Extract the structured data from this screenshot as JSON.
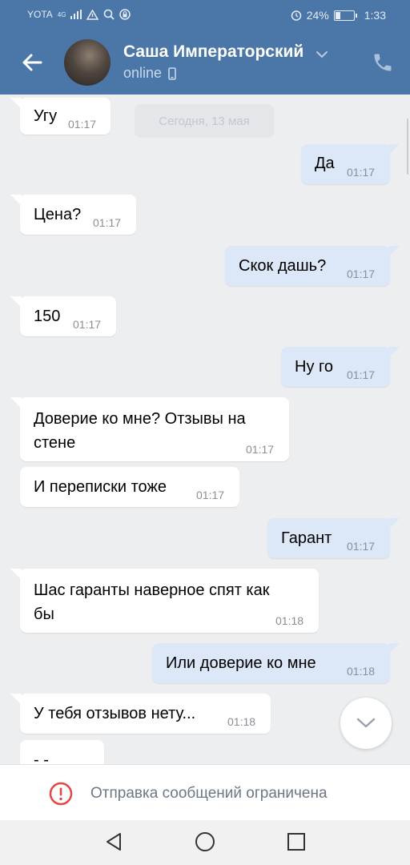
{
  "status_bar": {
    "carrier": "YOTA",
    "network": "4G",
    "battery": "24%",
    "battery_level": 0.24,
    "time": "1:33"
  },
  "header": {
    "contact_name": "Саша Императорский",
    "status": "online"
  },
  "chat": {
    "date_label": "Сегодня, 13 мая",
    "messages": [
      {
        "dir": "in",
        "text": "Угу",
        "time": "01:17"
      },
      {
        "dir": "out",
        "text": "Да",
        "time": "01:17"
      },
      {
        "dir": "in",
        "text": "Цена?",
        "time": "01:17"
      },
      {
        "dir": "out",
        "text": "Скок дашь?",
        "time": "01:17"
      },
      {
        "dir": "in",
        "text": "150",
        "time": "01:17"
      },
      {
        "dir": "out",
        "text": "Ну го",
        "time": "01:17"
      },
      {
        "dir": "in",
        "line1": "Доверие ко мне? Отзывы на",
        "line2": "стене",
        "time": "01:17"
      },
      {
        "dir": "in",
        "text": "И переписки тоже",
        "time": "01:17"
      },
      {
        "dir": "out",
        "text": "Гарант",
        "time": "01:17"
      },
      {
        "dir": "in",
        "line1": "Шас гаранты наверное спят как",
        "line2": "бы",
        "time": "01:18"
      },
      {
        "dir": "out",
        "text": "Или доверие ко мне",
        "time": "01:18"
      },
      {
        "dir": "in",
        "text": "У тебя отзывов нету...",
        "time": "01:18"
      },
      {
        "dir": "in",
        "text": "- -",
        "time": ""
      }
    ]
  },
  "restriction": {
    "text": "Отправка сообщений ограничена"
  },
  "colors": {
    "header_bg": "#4a76a8",
    "incoming_bubble": "#ffffff",
    "outgoing_bubble": "#dce8f7",
    "chat_bg": "#edeef0",
    "warning_red": "#e64646"
  },
  "icons": [
    "back-arrow-icon",
    "chevron-down-icon",
    "mobile-phone-icon",
    "phone-call-icon",
    "scroll-down-icon",
    "warning-icon",
    "nav-back-icon",
    "nav-home-icon",
    "nav-recents-icon"
  ]
}
